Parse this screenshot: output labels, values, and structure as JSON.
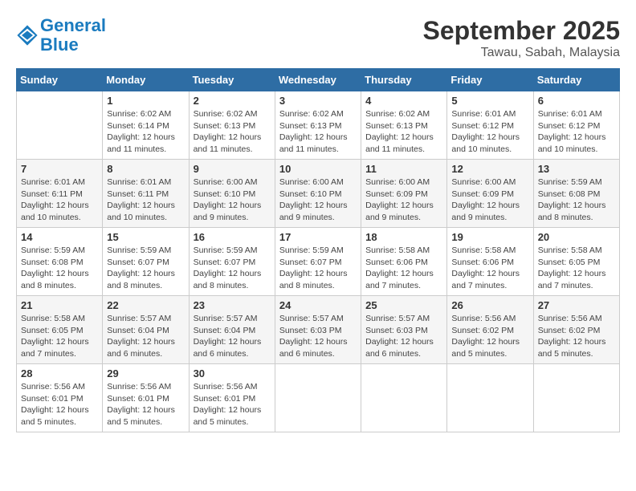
{
  "header": {
    "logo_line1": "General",
    "logo_line2": "Blue",
    "month": "September 2025",
    "location": "Tawau, Sabah, Malaysia"
  },
  "days_of_week": [
    "Sunday",
    "Monday",
    "Tuesday",
    "Wednesday",
    "Thursday",
    "Friday",
    "Saturday"
  ],
  "weeks": [
    [
      {
        "day": "",
        "info": ""
      },
      {
        "day": "1",
        "info": "Sunrise: 6:02 AM\nSunset: 6:14 PM\nDaylight: 12 hours\nand 11 minutes."
      },
      {
        "day": "2",
        "info": "Sunrise: 6:02 AM\nSunset: 6:13 PM\nDaylight: 12 hours\nand 11 minutes."
      },
      {
        "day": "3",
        "info": "Sunrise: 6:02 AM\nSunset: 6:13 PM\nDaylight: 12 hours\nand 11 minutes."
      },
      {
        "day": "4",
        "info": "Sunrise: 6:02 AM\nSunset: 6:13 PM\nDaylight: 12 hours\nand 11 minutes."
      },
      {
        "day": "5",
        "info": "Sunrise: 6:01 AM\nSunset: 6:12 PM\nDaylight: 12 hours\nand 10 minutes."
      },
      {
        "day": "6",
        "info": "Sunrise: 6:01 AM\nSunset: 6:12 PM\nDaylight: 12 hours\nand 10 minutes."
      }
    ],
    [
      {
        "day": "7",
        "info": "Sunrise: 6:01 AM\nSunset: 6:11 PM\nDaylight: 12 hours\nand 10 minutes."
      },
      {
        "day": "8",
        "info": "Sunrise: 6:01 AM\nSunset: 6:11 PM\nDaylight: 12 hours\nand 10 minutes."
      },
      {
        "day": "9",
        "info": "Sunrise: 6:00 AM\nSunset: 6:10 PM\nDaylight: 12 hours\nand 9 minutes."
      },
      {
        "day": "10",
        "info": "Sunrise: 6:00 AM\nSunset: 6:10 PM\nDaylight: 12 hours\nand 9 minutes."
      },
      {
        "day": "11",
        "info": "Sunrise: 6:00 AM\nSunset: 6:09 PM\nDaylight: 12 hours\nand 9 minutes."
      },
      {
        "day": "12",
        "info": "Sunrise: 6:00 AM\nSunset: 6:09 PM\nDaylight: 12 hours\nand 9 minutes."
      },
      {
        "day": "13",
        "info": "Sunrise: 5:59 AM\nSunset: 6:08 PM\nDaylight: 12 hours\nand 8 minutes."
      }
    ],
    [
      {
        "day": "14",
        "info": "Sunrise: 5:59 AM\nSunset: 6:08 PM\nDaylight: 12 hours\nand 8 minutes."
      },
      {
        "day": "15",
        "info": "Sunrise: 5:59 AM\nSunset: 6:07 PM\nDaylight: 12 hours\nand 8 minutes."
      },
      {
        "day": "16",
        "info": "Sunrise: 5:59 AM\nSunset: 6:07 PM\nDaylight: 12 hours\nand 8 minutes."
      },
      {
        "day": "17",
        "info": "Sunrise: 5:59 AM\nSunset: 6:07 PM\nDaylight: 12 hours\nand 8 minutes."
      },
      {
        "day": "18",
        "info": "Sunrise: 5:58 AM\nSunset: 6:06 PM\nDaylight: 12 hours\nand 7 minutes."
      },
      {
        "day": "19",
        "info": "Sunrise: 5:58 AM\nSunset: 6:06 PM\nDaylight: 12 hours\nand 7 minutes."
      },
      {
        "day": "20",
        "info": "Sunrise: 5:58 AM\nSunset: 6:05 PM\nDaylight: 12 hours\nand 7 minutes."
      }
    ],
    [
      {
        "day": "21",
        "info": "Sunrise: 5:58 AM\nSunset: 6:05 PM\nDaylight: 12 hours\nand 7 minutes."
      },
      {
        "day": "22",
        "info": "Sunrise: 5:57 AM\nSunset: 6:04 PM\nDaylight: 12 hours\nand 6 minutes."
      },
      {
        "day": "23",
        "info": "Sunrise: 5:57 AM\nSunset: 6:04 PM\nDaylight: 12 hours\nand 6 minutes."
      },
      {
        "day": "24",
        "info": "Sunrise: 5:57 AM\nSunset: 6:03 PM\nDaylight: 12 hours\nand 6 minutes."
      },
      {
        "day": "25",
        "info": "Sunrise: 5:57 AM\nSunset: 6:03 PM\nDaylight: 12 hours\nand 6 minutes."
      },
      {
        "day": "26",
        "info": "Sunrise: 5:56 AM\nSunset: 6:02 PM\nDaylight: 12 hours\nand 5 minutes."
      },
      {
        "day": "27",
        "info": "Sunrise: 5:56 AM\nSunset: 6:02 PM\nDaylight: 12 hours\nand 5 minutes."
      }
    ],
    [
      {
        "day": "28",
        "info": "Sunrise: 5:56 AM\nSunset: 6:01 PM\nDaylight: 12 hours\nand 5 minutes."
      },
      {
        "day": "29",
        "info": "Sunrise: 5:56 AM\nSunset: 6:01 PM\nDaylight: 12 hours\nand 5 minutes."
      },
      {
        "day": "30",
        "info": "Sunrise: 5:56 AM\nSunset: 6:01 PM\nDaylight: 12 hours\nand 5 minutes."
      },
      {
        "day": "",
        "info": ""
      },
      {
        "day": "",
        "info": ""
      },
      {
        "day": "",
        "info": ""
      },
      {
        "day": "",
        "info": ""
      }
    ]
  ]
}
